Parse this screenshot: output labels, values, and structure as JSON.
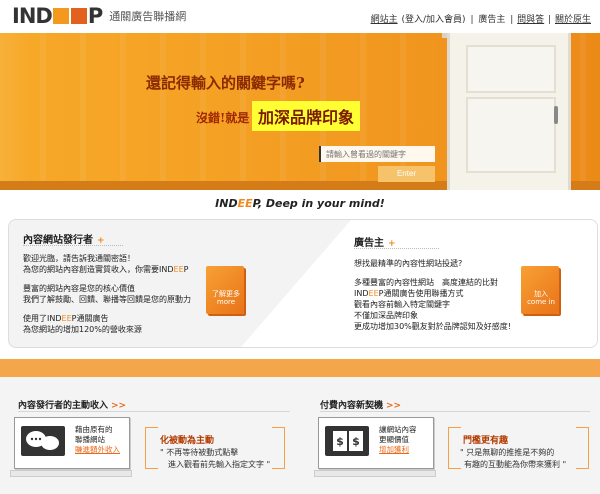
{
  "header": {
    "logo_ind": "IND",
    "logo_p": "P",
    "logo_sub": "通關廣告聯播網",
    "links": [
      "網站主",
      "(登入/加入會員)",
      "廣告主",
      "問與答",
      "關於原生"
    ],
    "separator": "|"
  },
  "hero": {
    "question": "還記得輸入的關鍵字嗎?",
    "answer_prefix": "沒錯!就是",
    "answer_highlight": "加深品牌印象",
    "search_placeholder": "請輸入曾看過的關鍵字",
    "enter_label": "Enter"
  },
  "slogan": {
    "part1": "IND",
    "part_ee": "EE",
    "part2": "P, Deep in your mind!"
  },
  "publisher_card": {
    "title": "內容網站發行者",
    "plus": "+",
    "lines": [
      "歡迎光臨，請告訴我通關密語！",
      "為您的網站內容創造實質收入，你需要INDEEP",
      "",
      "豐富的網站內容是您的核心價值",
      "我們了解鼓勵、回饋、聯播等回饋是您的原動力",
      "",
      "使用了INDEEP通關廣告",
      "為您網站的增加120%的營收來源"
    ],
    "book_label": "了解更多 more"
  },
  "advertiser_card": {
    "title": "廣告主",
    "plus": "+",
    "lines": [
      "想找最精準的內容性網站投遞?",
      "",
      "多種豐富的內容性網站　高度連結的比對",
      "INDEEP通關廣告使用聯播方式",
      "觀看內容前輸入特定關鍵字",
      "不僅加深品牌印象",
      "更成功增加30%觀友對於品牌認知及好感度!"
    ],
    "book_label": "加入 come in"
  },
  "publisher_income": {
    "title": "內容發行者的主動收入",
    "chevron": ">>",
    "box_lines": [
      "藉由原有的",
      "聯播網站"
    ],
    "box_link": "賺進額外收入",
    "highlight_title": "化被動為主動",
    "highlight_lines": [
      "\" 不再等待被動式點擊",
      "進入觀看前先輸入指定文字 \""
    ]
  },
  "paid_content": {
    "title": "付費內容新契機",
    "chevron": ">>",
    "box_lines": [
      "讓網站內容",
      "更顯價值"
    ],
    "box_link": "增加獲利",
    "highlight_title": "門檻更有趣",
    "highlight_lines": [
      "\" 只是無聊的推推是不夠的",
      "有趣的互動能為你帶來獲利 \""
    ]
  },
  "colors": {
    "brand_orange": "#f18a1e",
    "hero_bg": "#f4a024",
    "highlight_yellow": "#ffff33"
  }
}
